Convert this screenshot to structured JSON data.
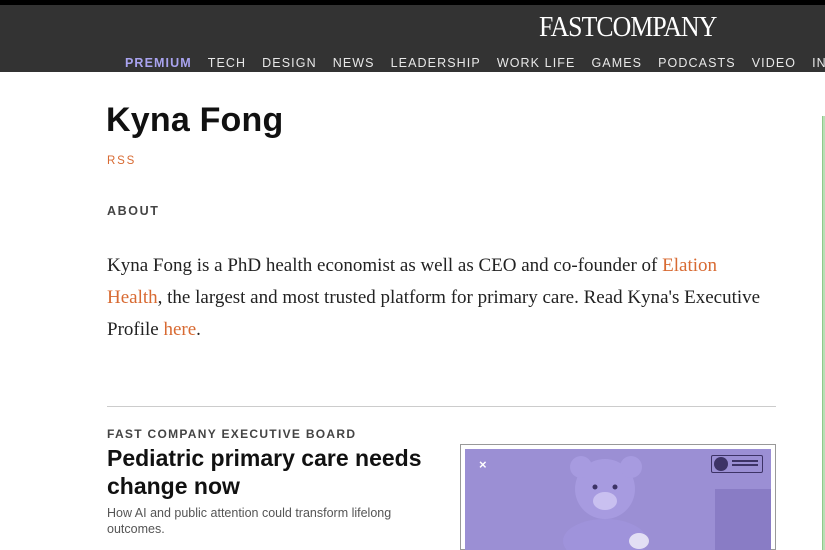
{
  "header": {
    "logo_text": "FASTCOMPANY",
    "nav": [
      {
        "label": "PREMIUM"
      },
      {
        "label": "TECH"
      },
      {
        "label": "DESIGN"
      },
      {
        "label": "NEWS"
      },
      {
        "label": "LEADERSHIP"
      },
      {
        "label": "WORK LIFE"
      },
      {
        "label": "GAMES"
      },
      {
        "label": "PODCASTS"
      },
      {
        "label": "VIDEO"
      },
      {
        "label": "INNOVA"
      }
    ]
  },
  "author": {
    "name": "Kyna Fong",
    "rss_label": "RSS",
    "about_label": "ABOUT",
    "bio": {
      "text_1": "Kyna Fong is a PhD health economist as well as CEO and co-founder of ",
      "link_1": "Elation Health",
      "text_2": ", the largest and most trusted platform for primary care. Read Kyna's Executive Profile ",
      "link_2": "here",
      "text_3": "."
    }
  },
  "article": {
    "kicker": "FAST COMPANY EXECUTIVE BOARD",
    "headline": "Pediatric primary care needs change now",
    "dek": "How AI and public attention could transform lifelong outcomes.",
    "thumbnail_close_icon": "×"
  },
  "colors": {
    "header_bg": "#333333",
    "premium": "#a9a3ef",
    "accent_link": "#d86a32",
    "thumb_tint": "#8c7ec9"
  }
}
